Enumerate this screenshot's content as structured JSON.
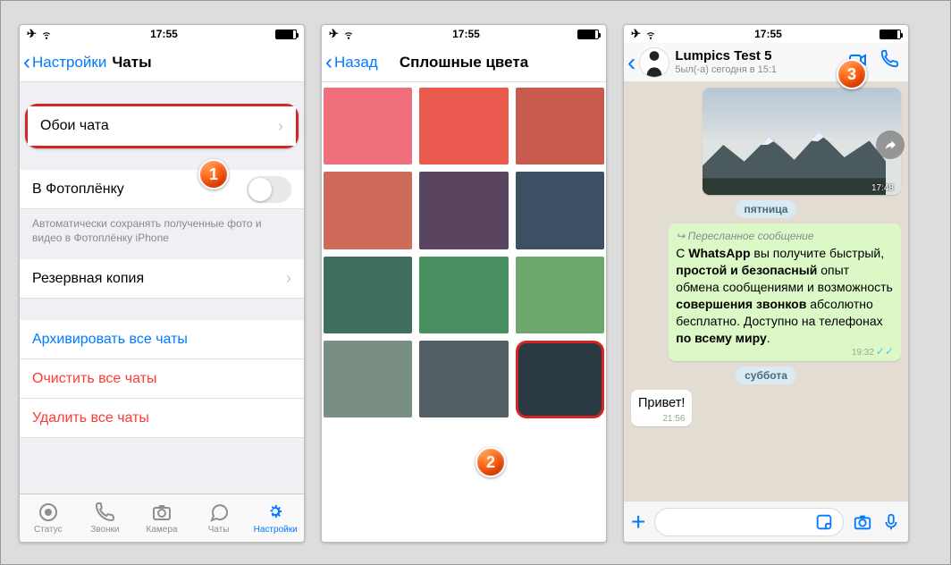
{
  "statusbar": {
    "time": "17:55"
  },
  "screen1": {
    "back_label": "Настройки",
    "title": "Чаты",
    "wallpaper_cell": "Обои чата",
    "camera_roll_cell": "В Фотоплёнку",
    "camera_roll_note": "Автоматически сохранять полученные фото и видео в Фотоплёнку iPhone",
    "backup_cell": "Резервная копия",
    "archive_all": "Архивировать все чаты",
    "clear_all": "Очистить все чаты",
    "delete_all": "Удалить все чаты",
    "tabs": {
      "status": "Статус",
      "calls": "Звонки",
      "camera": "Камера",
      "chats": "Чаты",
      "settings": "Настройки"
    }
  },
  "screen2": {
    "back_label": "Назад",
    "title": "Сплошные цвета",
    "colors": [
      "#ef6f7c",
      "#ea5a4f",
      "#c95a4e",
      "#cf6b5a",
      "#5a4560",
      "#3d4f63",
      "#3f6f60",
      "#4a8f60",
      "#6ea76b",
      "#7a8f84",
      "#525e63",
      "#2b3a42"
    ],
    "selected_index": 11
  },
  "screen3": {
    "contact_name": "Lumpics Test 5",
    "contact_status": "5ыл(-а) сегодня в 15:1",
    "image_time": "17:48",
    "day1": "пятница",
    "day2": "суббота",
    "fwd_label": "Пересланное сообщение",
    "msg_parts": {
      "a": "С ",
      "b": "WhatsApp",
      "c": " вы получите быстрый, ",
      "d": "простой и безопасный",
      "e": " опыт обмена сообщениями и возможность ",
      "f": "совершения звонков",
      "g": " абсолютно бесплатно. Доступно на телефонах ",
      "h": "по всему миру",
      "i": "."
    },
    "msg_time": "19:32",
    "hello": "Привет!",
    "hello_time": "21:56"
  },
  "badges": {
    "n1": "1",
    "n2": "2",
    "n3": "3"
  }
}
